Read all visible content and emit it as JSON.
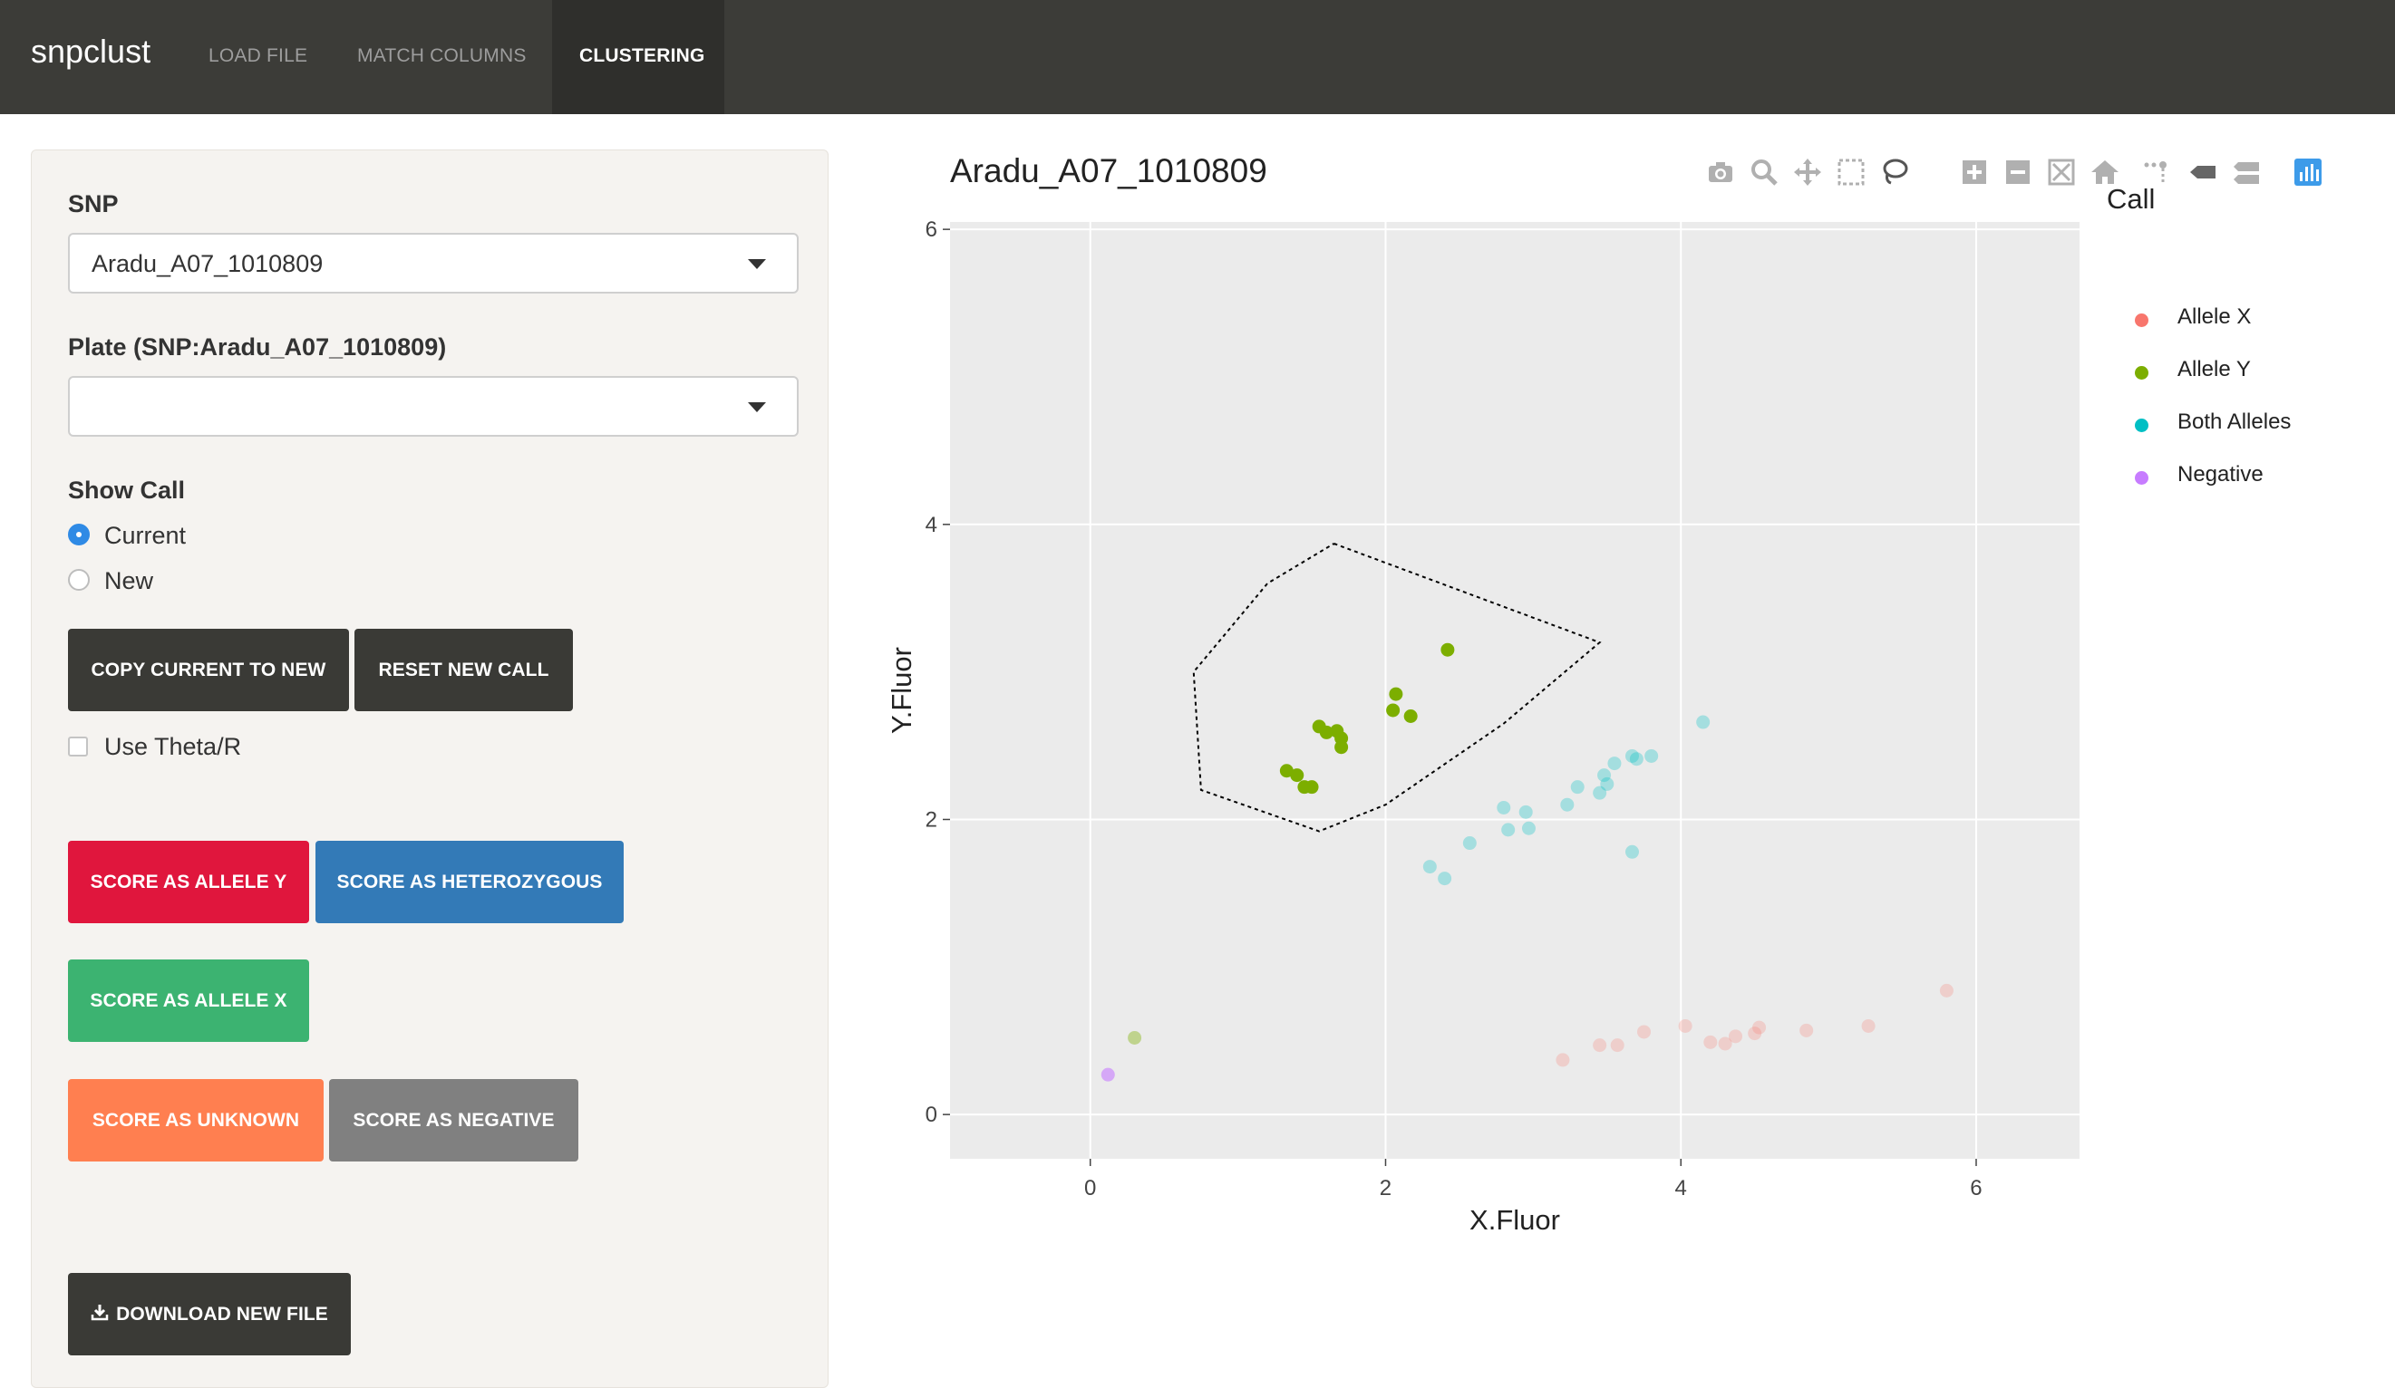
{
  "app": {
    "brand": "snpclust",
    "tabs": [
      {
        "label": "LOAD FILE"
      },
      {
        "label": "MATCH COLUMNS"
      },
      {
        "label": "CLUSTERING",
        "active": true
      }
    ]
  },
  "sidebar": {
    "snp_label": "SNP",
    "snp_value": "Aradu_A07_1010809",
    "plate_label": "Plate (SNP:Aradu_A07_1010809)",
    "plate_value": "",
    "show_call_label": "Show Call",
    "show_call_options": [
      {
        "label": "Current",
        "checked": true
      },
      {
        "label": "New",
        "checked": false
      }
    ],
    "copy_button": "COPY CURRENT TO NEW",
    "reset_button": "RESET NEW CALL",
    "theta_checkbox": "Use Theta/R",
    "score_allele_y": "SCORE AS ALLELE Y",
    "score_het": "SCORE AS HETEROZYGOUS",
    "score_allele_x": "SCORE AS ALLELE X",
    "score_unknown": "SCORE AS UNKNOWN",
    "score_negative": "SCORE AS NEGATIVE",
    "download_button": "DOWNLOAD NEW FILE"
  },
  "modebar": {
    "icons": [
      "camera-icon",
      "zoom-icon",
      "pan-icon",
      "box-select-icon",
      "lasso-select-icon",
      "zoom-in-icon",
      "zoom-out-icon",
      "autoscale-icon",
      "reset-axes-icon",
      "spike-lines-icon",
      "hover-closest-icon",
      "hover-compare-icon",
      "plotly-logo-icon"
    ]
  },
  "colors": {
    "allele_x": "#f8766d",
    "allele_y": "#7cae00",
    "both_alleles": "#00bfc4",
    "negative": "#c77cff",
    "plot_bg": "#ebebeb"
  },
  "chart_data": {
    "type": "scatter",
    "title": "Aradu_A07_1010809",
    "xlabel": "X.Fluor",
    "ylabel": "Y.Fluor",
    "xlim": [
      -0.95,
      6.7
    ],
    "ylim": [
      -0.3,
      6.05
    ],
    "xticks": [
      0,
      2,
      4,
      6
    ],
    "yticks": [
      0,
      2,
      4,
      6
    ],
    "grid": true,
    "legend_title": "Call",
    "legend_position": "right",
    "series": [
      {
        "name": "Allele X",
        "color": "#f8766d",
        "opacity": 0.25,
        "points": [
          [
            3.2,
            0.37
          ],
          [
            3.45,
            0.47
          ],
          [
            3.57,
            0.47
          ],
          [
            3.75,
            0.56
          ],
          [
            4.03,
            0.6
          ],
          [
            4.2,
            0.49
          ],
          [
            4.3,
            0.48
          ],
          [
            4.37,
            0.53
          ],
          [
            4.5,
            0.55
          ],
          [
            4.53,
            0.59
          ],
          [
            4.85,
            0.57
          ],
          [
            5.27,
            0.6
          ],
          [
            5.8,
            0.84
          ]
        ]
      },
      {
        "name": "Allele Y",
        "color": "#7cae00",
        "opacity": 1.0,
        "points": [
          [
            1.33,
            2.33
          ],
          [
            1.4,
            2.3
          ],
          [
            1.45,
            2.22
          ],
          [
            1.5,
            2.22
          ],
          [
            1.55,
            2.63
          ],
          [
            1.6,
            2.59
          ],
          [
            1.67,
            2.6
          ],
          [
            1.7,
            2.55
          ],
          [
            1.7,
            2.49
          ],
          [
            2.05,
            2.74
          ],
          [
            2.07,
            2.85
          ],
          [
            2.17,
            2.7
          ],
          [
            2.42,
            3.15
          ]
        ]
      },
      {
        "name": "Both Alleles",
        "color": "#00bfc4",
        "opacity": 0.3,
        "points": [
          [
            2.3,
            1.68
          ],
          [
            2.4,
            1.6
          ],
          [
            2.57,
            1.84
          ],
          [
            2.8,
            2.08
          ],
          [
            2.83,
            1.93
          ],
          [
            2.95,
            2.05
          ],
          [
            2.97,
            1.94
          ],
          [
            3.23,
            2.1
          ],
          [
            3.3,
            2.22
          ],
          [
            3.45,
            2.18
          ],
          [
            3.48,
            2.3
          ],
          [
            3.5,
            2.24
          ],
          [
            3.55,
            2.38
          ],
          [
            3.67,
            2.43
          ],
          [
            3.7,
            2.41
          ],
          [
            3.67,
            1.78
          ],
          [
            3.8,
            2.43
          ],
          [
            4.15,
            2.66
          ]
        ]
      },
      {
        "name": "Negative",
        "color": "#c77cff",
        "opacity": 0.6,
        "points": [
          [
            0.12,
            0.27
          ]
        ]
      },
      {
        "name": "",
        "color": "#7cae00",
        "opacity": 0.4,
        "points": [
          [
            0.3,
            0.52
          ]
        ]
      }
    ],
    "lasso_polygon": [
      [
        1.65,
        3.87
      ],
      [
        3.45,
        3.2
      ],
      [
        2.8,
        2.65
      ],
      [
        2.0,
        2.1
      ],
      [
        1.55,
        1.92
      ],
      [
        0.75,
        2.2
      ],
      [
        0.7,
        3.0
      ],
      [
        1.2,
        3.6
      ],
      [
        1.65,
        3.87
      ]
    ]
  }
}
